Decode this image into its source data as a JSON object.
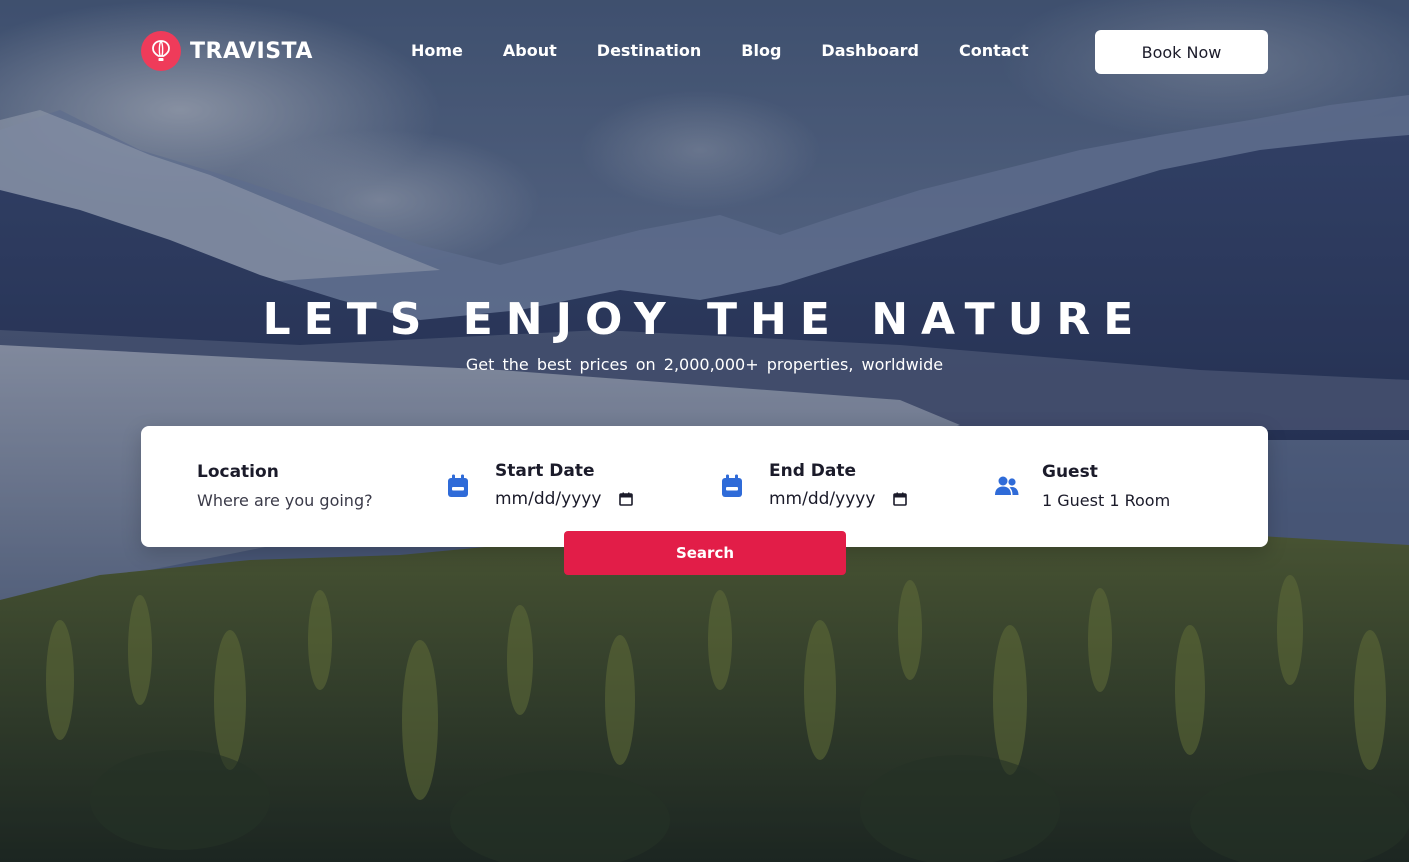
{
  "brand": {
    "name": "TRAVISTA",
    "icon": "hot-air-balloon-icon",
    "accent": "#ef3b5a"
  },
  "nav": {
    "items": [
      {
        "label": "Home"
      },
      {
        "label": "About"
      },
      {
        "label": "Destination"
      },
      {
        "label": "Blog"
      },
      {
        "label": "Dashboard"
      },
      {
        "label": "Contact"
      }
    ],
    "cta_label": "Book Now"
  },
  "hero": {
    "title": "LETS ENJOY THE NATURE",
    "subtitle": "Get the best prices on 2,000,000+ properties, worldwide"
  },
  "search": {
    "location": {
      "title": "Location",
      "placeholder": "Where are you going?"
    },
    "start_date": {
      "title": "Start Date",
      "value": "mm/dd/yyyy",
      "icon": "calendar-icon"
    },
    "end_date": {
      "title": "End Date",
      "value": "mm/dd/yyyy",
      "icon": "calendar-icon"
    },
    "guest": {
      "title": "Guest",
      "value": "1 Guest 1 Room",
      "icon": "users-icon"
    },
    "button_label": "Search",
    "button_color": "#e21d48",
    "icon_color": "#2f6bd8"
  }
}
